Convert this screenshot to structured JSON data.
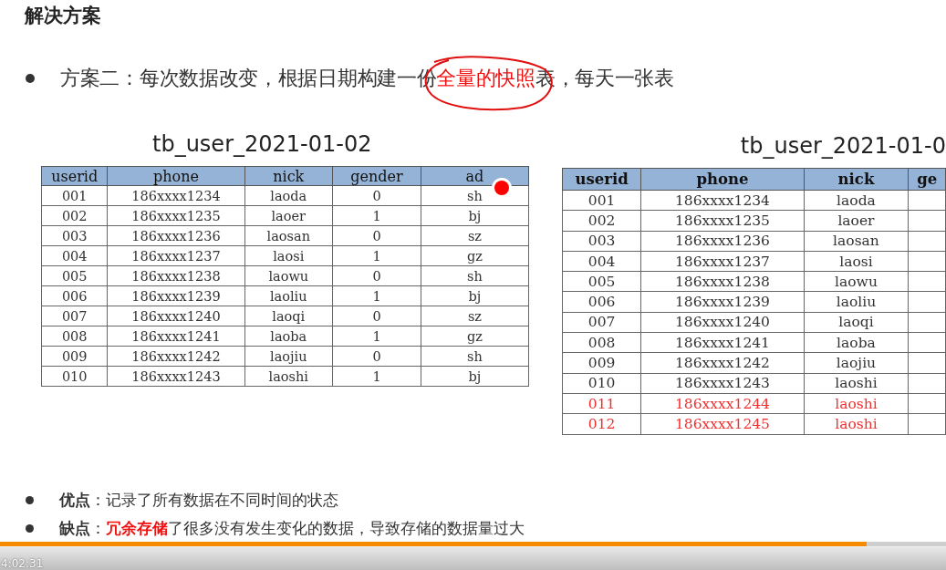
{
  "heading": "解决方案",
  "points": [
    {
      "parts": [
        {
          "text": "方案二：每次数据改变，根据日期构建一份",
          "kind": "plain"
        },
        {
          "text": "全量的快照",
          "kind": "highlight"
        },
        {
          "text": "表，每天一张表",
          "kind": "plain"
        }
      ]
    }
  ],
  "tables": [
    {
      "title": "tb_user_2021-01-02",
      "columns": [
        "userid",
        "phone",
        "nick",
        "gender",
        "ad"
      ],
      "rows": [
        {
          "cells": [
            "001",
            "186xxxx1234",
            "laoda",
            "0",
            "sh"
          ],
          "new": false
        },
        {
          "cells": [
            "002",
            "186xxxx1235",
            "laoer",
            "1",
            "bj"
          ],
          "new": false
        },
        {
          "cells": [
            "003",
            "186xxxx1236",
            "laosan",
            "0",
            "sz"
          ],
          "new": false
        },
        {
          "cells": [
            "004",
            "186xxxx1237",
            "laosi",
            "1",
            "gz"
          ],
          "new": false
        },
        {
          "cells": [
            "005",
            "186xxxx1238",
            "laowu",
            "0",
            "sh"
          ],
          "new": false
        },
        {
          "cells": [
            "006",
            "186xxxx1239",
            "laoliu",
            "1",
            "bj"
          ],
          "new": false
        },
        {
          "cells": [
            "007",
            "186xxxx1240",
            "laoqi",
            "0",
            "sz"
          ],
          "new": false
        },
        {
          "cells": [
            "008",
            "186xxxx1241",
            "laoba",
            "1",
            "gz"
          ],
          "new": false
        },
        {
          "cells": [
            "009",
            "186xxxx1242",
            "laojiu",
            "0",
            "sh"
          ],
          "new": false
        },
        {
          "cells": [
            "010",
            "186xxxx1243",
            "laoshi",
            "1",
            "bj"
          ],
          "new": false
        }
      ]
    },
    {
      "title": "tb_user_2021-01-0",
      "columns": [
        "userid",
        "phone",
        "nick",
        "ge"
      ],
      "rows": [
        {
          "cells": [
            "001",
            "186xxxx1234",
            "laoda"
          ],
          "new": false
        },
        {
          "cells": [
            "002",
            "186xxxx1235",
            "laoer"
          ],
          "new": false
        },
        {
          "cells": [
            "003",
            "186xxxx1236",
            "laosan"
          ],
          "new": false
        },
        {
          "cells": [
            "004",
            "186xxxx1237",
            "laosi"
          ],
          "new": false
        },
        {
          "cells": [
            "005",
            "186xxxx1238",
            "laowu"
          ],
          "new": false
        },
        {
          "cells": [
            "006",
            "186xxxx1239",
            "laoliu"
          ],
          "new": false
        },
        {
          "cells": [
            "007",
            "186xxxx1240",
            "laoqi"
          ],
          "new": false
        },
        {
          "cells": [
            "008",
            "186xxxx1241",
            "laoba"
          ],
          "new": false
        },
        {
          "cells": [
            "009",
            "186xxxx1242",
            "laojiu"
          ],
          "new": false
        },
        {
          "cells": [
            "010",
            "186xxxx1243",
            "laoshi"
          ],
          "new": false
        },
        {
          "cells": [
            "011",
            "186xxxx1244",
            "laoshi"
          ],
          "new": true
        },
        {
          "cells": [
            "012",
            "186xxxx1245",
            "laoshi"
          ],
          "new": true
        }
      ]
    }
  ],
  "notes": [
    {
      "parts": [
        {
          "text": "优点",
          "kind": "label"
        },
        {
          "text": "：记录了所有数据在不同时间的状态",
          "kind": "plain"
        }
      ]
    },
    {
      "parts": [
        {
          "text": "缺点",
          "kind": "label"
        },
        {
          "text": "：",
          "kind": "plain"
        },
        {
          "text": "冗余存储",
          "kind": "warning"
        },
        {
          "text": "了很多没有发生变化的数据，导致存储的数据量过大",
          "kind": "plain"
        }
      ]
    }
  ],
  "player": {
    "level": 0.916,
    "time": "4:02:31"
  }
}
